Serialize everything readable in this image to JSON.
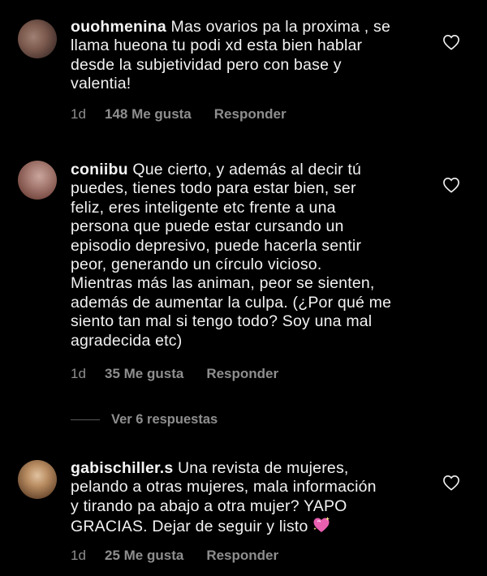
{
  "comments": [
    {
      "username": "ouohmenina",
      "text": "Mas ovarios pa la proxima , se\nllama hueona tu podi xd esta bien hablar\ndesde la subjetividad pero con base y\nvalentia!",
      "age": "1d",
      "likes": "148 Me gusta",
      "reply": "Responder"
    },
    {
      "username": "coniibu",
      "text": "Que cierto, y además al decir tú\npuedes, tienes todo para estar bien, ser\nfeliz, eres inteligente etc frente a una\npersona que puede estar cursando un\nepisodio depresivo, puede hacerla sentir\npeor, generando un círculo vicioso.\nMientras más las animan, peor se sienten,\nademás de aumentar la culpa. (¿Por qué me\nsiento tan mal si tengo todo? Soy una mal\nagradecida etc)",
      "age": "1d",
      "likes": "35 Me gusta",
      "reply": "Responder",
      "view_replies": "Ver 6 respuestas"
    },
    {
      "username": "gabischiller.s",
      "text": "Una revista de mujeres,\npelando a otras mujeres, mala información\ny tirando pa abajo a otra mujer? YAPO\nGRACIAS. Dejar de seguir y listo",
      "age": "1d",
      "likes": "25 Me gusta",
      "reply": "Responder",
      "emoji": "sparkling-heart-icon"
    }
  ],
  "colors": {
    "background": "#000000",
    "text": "#f2f2f2",
    "muted": "#8e8e8e",
    "emoji_heart": "#e85fb0"
  }
}
